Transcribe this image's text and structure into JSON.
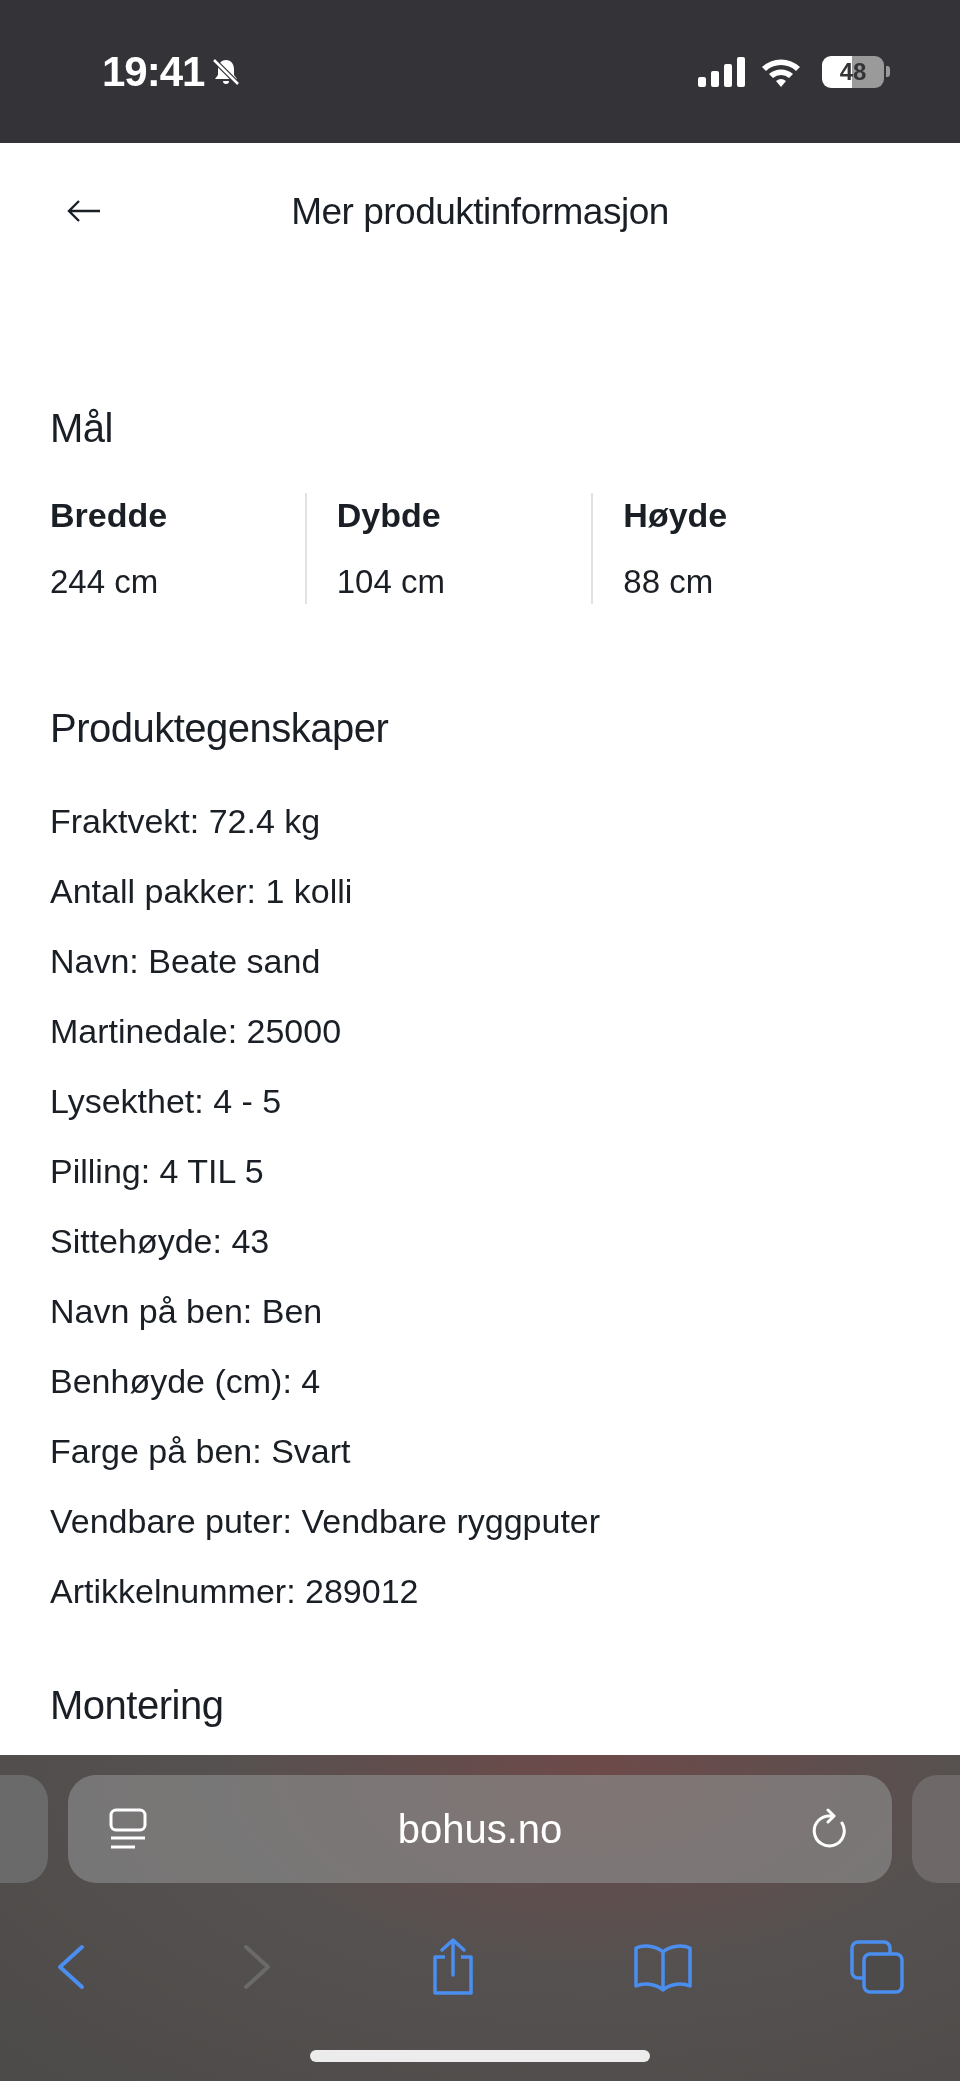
{
  "status_bar": {
    "time": "19:41",
    "battery": "48"
  },
  "header": {
    "title": "Mer produktinformasjon"
  },
  "dimensions": {
    "title": "Mål",
    "items": [
      {
        "label": "Bredde",
        "value": "244 cm"
      },
      {
        "label": "Dybde",
        "value": "104 cm"
      },
      {
        "label": "Høyde",
        "value": "88 cm"
      }
    ]
  },
  "properties": {
    "title": "Produktegenskaper",
    "items": [
      "Fraktvekt: 72.4 kg",
      "Antall pakker: 1 kolli",
      "Navn: Beate sand",
      "Martinedale: 25000",
      "Lysekthet: 4 - 5",
      "Pilling: 4 TIL 5",
      "Sittehøyde: 43",
      "Navn på ben: Ben",
      "Benhøyde (cm): 4",
      "Farge på ben: Svart",
      "Vendbare puter: Vendbare ryggputer",
      "Artikkelnummer: 289012"
    ]
  },
  "next_section": {
    "title": "Montering"
  },
  "browser": {
    "url": "bohus.no",
    "forward_disabled": true
  }
}
